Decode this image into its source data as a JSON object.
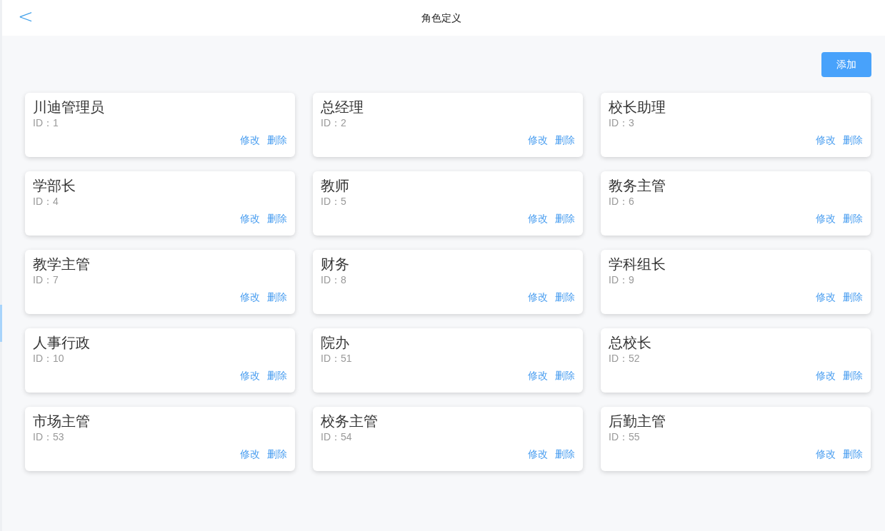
{
  "header": {
    "back": "<",
    "title": "角色定义"
  },
  "add_button": "添加",
  "roles": [
    {
      "name": "川迪管理员",
      "id": "ID：1",
      "actions": [
        "修改",
        "删除"
      ]
    },
    {
      "name": "总经理",
      "id": "ID：2",
      "actions": [
        "修改",
        "删除"
      ]
    },
    {
      "name": "校长助理",
      "id": "ID：3",
      "actions": [
        "修改",
        "删除"
      ]
    },
    {
      "name": "学部长",
      "id": "ID：4",
      "actions": [
        "修改",
        "删除"
      ]
    },
    {
      "name": "教师",
      "id": "ID：5",
      "actions": [
        "修改",
        "删除"
      ]
    },
    {
      "name": "教务主管",
      "id": "ID：6",
      "actions": [
        "修改",
        "删除"
      ]
    },
    {
      "name": "教学主管",
      "id": "ID：7",
      "actions": [
        "修改",
        "删除"
      ]
    },
    {
      "name": "财务",
      "id": "ID：8",
      "actions": [
        "修改",
        "删除"
      ]
    },
    {
      "name": "学科组长",
      "id": "ID：9",
      "actions": [
        "修改",
        "删除"
      ]
    },
    {
      "name": "人事行政",
      "id": "ID：10",
      "actions": [
        "修改",
        "删除"
      ]
    },
    {
      "name": "院办",
      "id": "ID：51",
      "actions": [
        "修改",
        "删除"
      ]
    },
    {
      "name": "总校长",
      "id": "ID：52",
      "actions": [
        "修改",
        "删除"
      ]
    },
    {
      "name": "市场主管",
      "id": "ID：53",
      "actions": [
        "修改",
        "删除"
      ]
    },
    {
      "name": "校务主管",
      "id": "ID：54",
      "actions": [
        "修改",
        "删除"
      ]
    },
    {
      "name": "后勤主管",
      "id": "ID：55",
      "actions": [
        "修改",
        "删除"
      ]
    }
  ]
}
